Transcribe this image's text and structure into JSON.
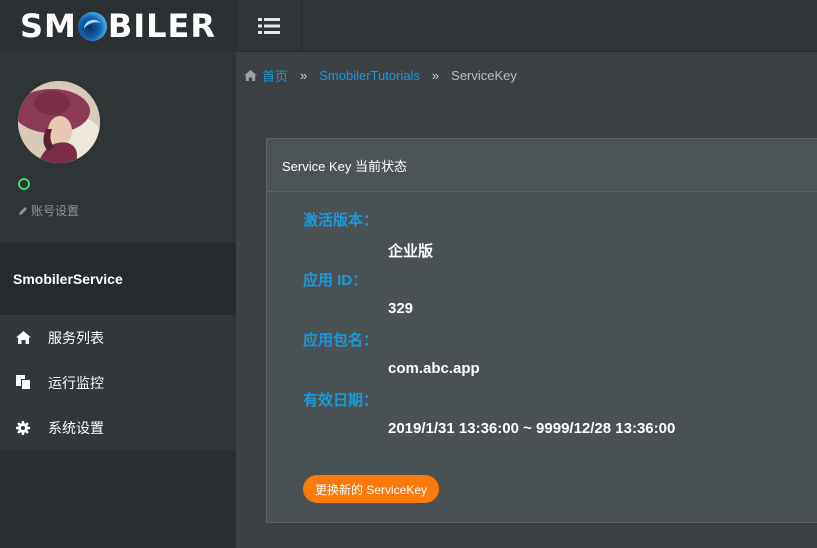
{
  "header": {
    "logo_left": "SM",
    "logo_right": "BILER"
  },
  "sidebar": {
    "account_settings": "账号设置",
    "service_name": "SmobilerService",
    "items": [
      {
        "label": "服务列表",
        "icon": "home-icon"
      },
      {
        "label": "运行监控",
        "icon": "copy-icon"
      },
      {
        "label": "系统设置",
        "icon": "gear-icon"
      }
    ]
  },
  "breadcrumb": {
    "home": "首页",
    "project": "SmobilerTutorials",
    "current": "ServiceKey",
    "separator": "»"
  },
  "panel": {
    "title": "Service Key 当前状态",
    "fields": [
      {
        "label": "激活版本：",
        "value": "企业版"
      },
      {
        "label": "应用 ID：",
        "value": "329"
      },
      {
        "label": "应用包名：",
        "value": "com.abc.app"
      },
      {
        "label": "有效日期：",
        "value": "2019/1/31 13:36:00 ~ 9999/12/28 13:36:00"
      }
    ],
    "button_label": "更换新的 ServiceKey"
  },
  "colors": {
    "accent": "#1a9ad6",
    "button": "#ff7a0a",
    "status_online": "#3fd46b"
  }
}
